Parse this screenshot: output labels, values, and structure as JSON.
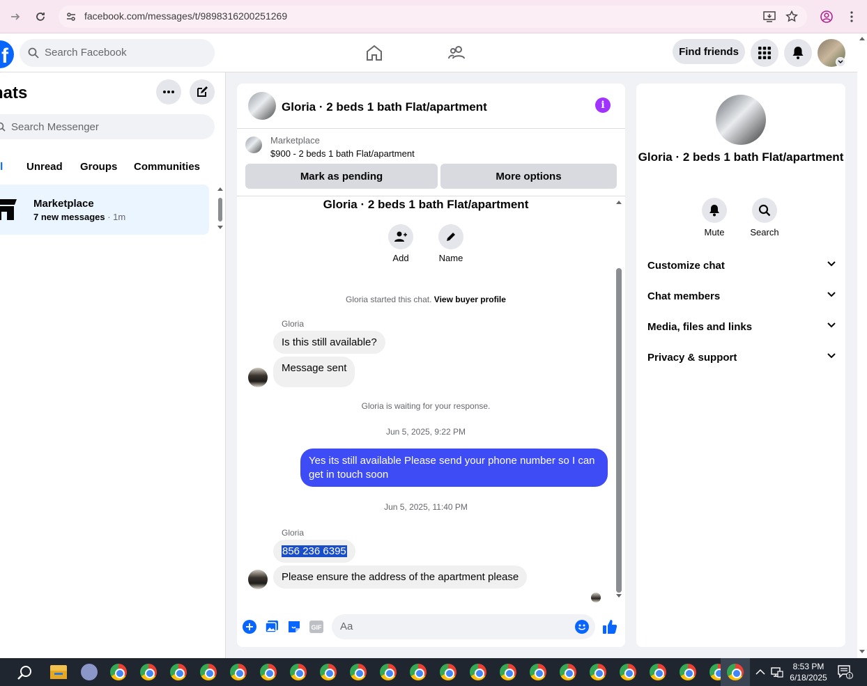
{
  "browser": {
    "url": "facebook.com/messages/t/9898316200251269"
  },
  "fb_nav": {
    "search_placeholder": "Search Facebook",
    "find_friends": "Find friends"
  },
  "chats": {
    "title": "hats",
    "search_placeholder": "Search Messenger",
    "filters": [
      "ll",
      "Unread",
      "Groups",
      "Communities"
    ],
    "item": {
      "name": "Marketplace",
      "sub": "7 new messages",
      "time": " · 1m"
    }
  },
  "conversation": {
    "title": "Gloria · 2 beds 1 bath Flat/apartment",
    "marketplace_label": "Marketplace",
    "listing": "$900 - 2 beds 1 bath Flat/apartment",
    "mark_pending": "Mark as pending",
    "more_options": "More options",
    "thread_title": "Gloria · 2 beds 1 bath Flat/apartment",
    "add_label": "Add",
    "name_label": "Name",
    "started_text": "Gloria started this chat. ",
    "view_buyer": "View buyer profile",
    "sender1": "Gloria",
    "msg1": "Is this still available?",
    "msg2": "Message sent",
    "waiting": "Gloria is waiting for your response.",
    "date1": "Jun 5, 2025, 9:22 PM",
    "my_msg": "Yes its still available Please send your phone number so I can get in touch soon",
    "date2": "Jun 5, 2025, 11:40 PM",
    "sender2": "Gloria",
    "phone": "856 236 6395",
    "msg3": "Please ensure the address of the apartment please",
    "composer_placeholder": "Aa"
  },
  "info_panel": {
    "name": "Gloria · 2 beds 1 bath Flat/apartment",
    "mute": "Mute",
    "search": "Search",
    "rows": [
      "Customize chat",
      "Chat members",
      "Media, files and links",
      "Privacy & support"
    ]
  },
  "taskbar": {
    "time": "8:53 PM",
    "date": "6/18/2025"
  },
  "colors": {
    "accent": "#0866ff",
    "my_bubble": "#3e4cf5",
    "info_icon": "#a033ff"
  }
}
